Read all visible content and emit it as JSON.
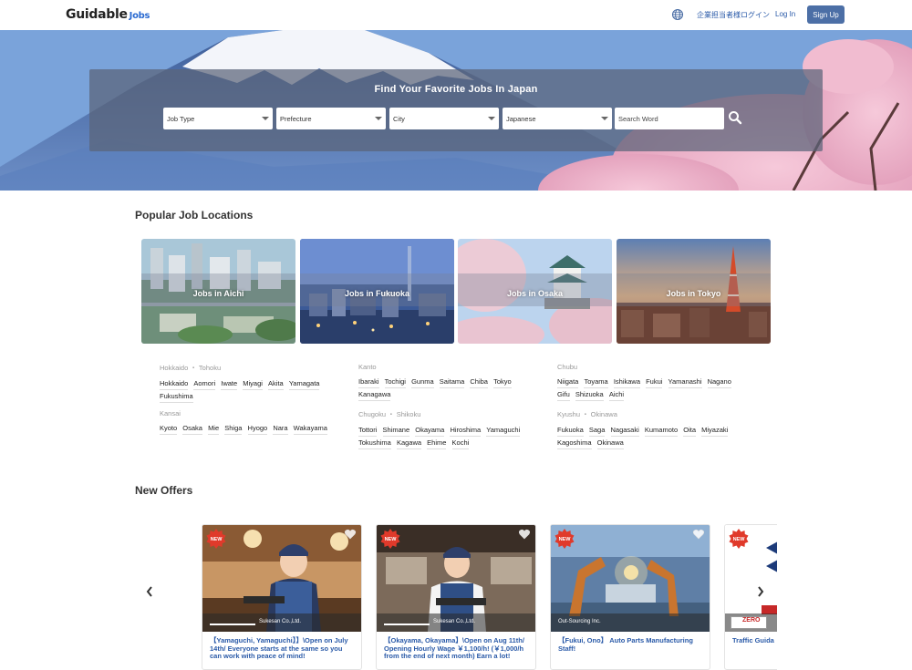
{
  "header": {
    "logo_text": "Guidable",
    "logo_suffix": "Jobs",
    "corp_login": "企業担当者様ログイン",
    "login": "Log In",
    "signup": "Sign Up"
  },
  "search": {
    "title": "Find Your Favorite Jobs In Japan",
    "job_type": "Job Type",
    "prefecture": "Prefecture",
    "city": "City",
    "language": "Japanese",
    "word_placeholder": "Search Word"
  },
  "locations": {
    "title": "Popular Job Locations",
    "cards": [
      {
        "label": "Jobs in Aichi"
      },
      {
        "label": "Jobs in Fukuoka"
      },
      {
        "label": "Jobs in Osaka"
      },
      {
        "label": "Jobs in Tokyo"
      }
    ],
    "regions": [
      {
        "name": "Hokkaido ・ Tohoku",
        "prefs": [
          "Hokkaido",
          "Aomori",
          "Iwate",
          "Miyagi",
          "Akita",
          "Yamagata",
          "Fukushima"
        ]
      },
      {
        "name": "Kanto",
        "prefs": [
          "Ibaraki",
          "Tochigi",
          "Gunma",
          "Saitama",
          "Chiba",
          "Tokyo",
          "Kanagawa"
        ]
      },
      {
        "name": "Chubu",
        "prefs": [
          "Niigata",
          "Toyama",
          "Ishikawa",
          "Fukui",
          "Yamanashi",
          "Nagano",
          "Gifu",
          "Shizuoka",
          "Aichi"
        ]
      },
      {
        "name": "Kansai",
        "prefs": [
          "Kyoto",
          "Osaka",
          "Mie",
          "Shiga",
          "Hyogo",
          "Nara",
          "Wakayama"
        ]
      },
      {
        "name": "Chugoku ・ Shikoku",
        "prefs": [
          "Tottori",
          "Shimane",
          "Okayama",
          "Hiroshima",
          "Yamaguchi",
          "Tokushima",
          "Kagawa",
          "Ehime",
          "Kochi"
        ]
      },
      {
        "name": "Kyushu ・ Okinawa",
        "prefs": [
          "Fukuoka",
          "Saga",
          "Nagasaki",
          "Kumamoto",
          "Oita",
          "Miyazaki",
          "Kagoshima",
          "Okinawa"
        ]
      }
    ]
  },
  "offers": {
    "title": "New Offers",
    "badge": "NEW",
    "items": [
      {
        "company": "Sukesan Co.,Ltd.",
        "title": "【Yamaguchi, Yamaguchi】】\\Open on July 14th/ Everyone starts at the same so you can work with peace of mind!"
      },
      {
        "company": "Sukesan Co.,Ltd.",
        "title": "【Okayama, Okayama】\\Open on Aug 11th/ Opening Hourly Wage ￥1,100/h! (￥1,000/h from the end of next month) Earn a lot!"
      },
      {
        "company": "Out-Sourcing Inc.",
        "title": "【Fukui, Ono】 Auto Parts Manufacturing Staff!"
      },
      {
        "company": "ZERO",
        "title": "Traffic Guida"
      }
    ]
  },
  "colors": {
    "brand_blue": "#2a5aa8",
    "signup_bg": "#4c6fa6",
    "new_badge": "#e03a2b"
  }
}
